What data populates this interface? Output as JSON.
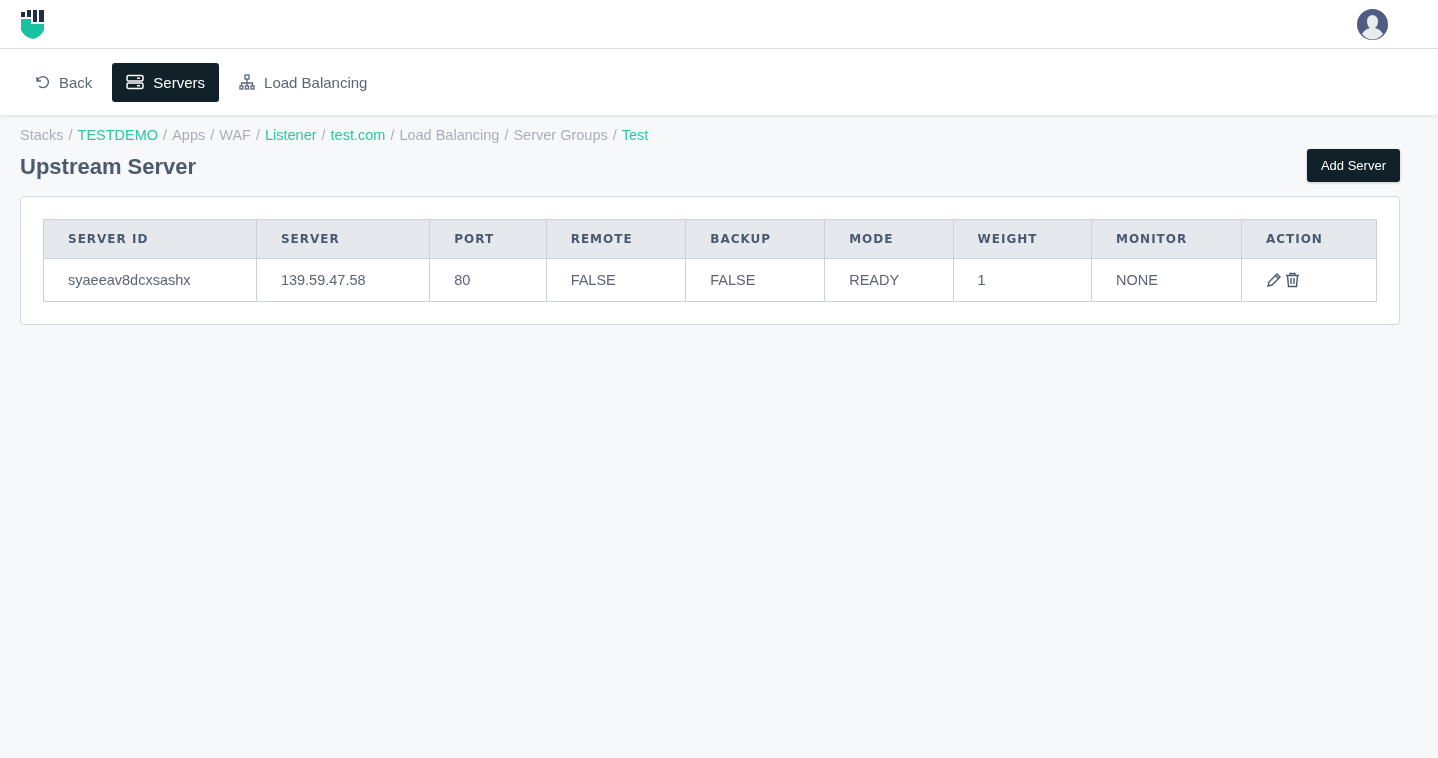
{
  "nav": {
    "tabs": [
      {
        "kind": "back",
        "label": "Back",
        "selected": false
      },
      {
        "kind": "servers",
        "label": "Servers",
        "selected": true
      },
      {
        "kind": "network",
        "label": "Load Balancing",
        "selected": false
      }
    ]
  },
  "breadcrumb_separator": "/",
  "breadcrumb": [
    {
      "label": "Stacks",
      "kind": "plain"
    },
    {
      "label": "TESTDEMO",
      "kind": "link"
    },
    {
      "label": "Apps",
      "kind": "plain"
    },
    {
      "label": "WAF",
      "kind": "plain"
    },
    {
      "label": "Listener",
      "kind": "link"
    },
    {
      "label": "test.com",
      "kind": "link"
    },
    {
      "label": "Load Balancing",
      "kind": "plain"
    },
    {
      "label": "Server Groups",
      "kind": "plain"
    },
    {
      "label": "Test",
      "kind": "link"
    }
  ],
  "page": {
    "title": "Upstream Server",
    "add_button": "Add Server"
  },
  "table": {
    "columns": [
      "SERVER ID",
      "SERVER",
      "PORT",
      "REMOTE",
      "BACKUP",
      "MODE",
      "WEIGHT",
      "MONITOR",
      "ACTION"
    ],
    "rows": [
      {
        "cells": [
          "syaeeav8dcxsashx",
          "139.59.47.58",
          "80",
          "FALSE",
          "FALSE",
          "READY",
          "1",
          "NONE"
        ]
      }
    ]
  }
}
